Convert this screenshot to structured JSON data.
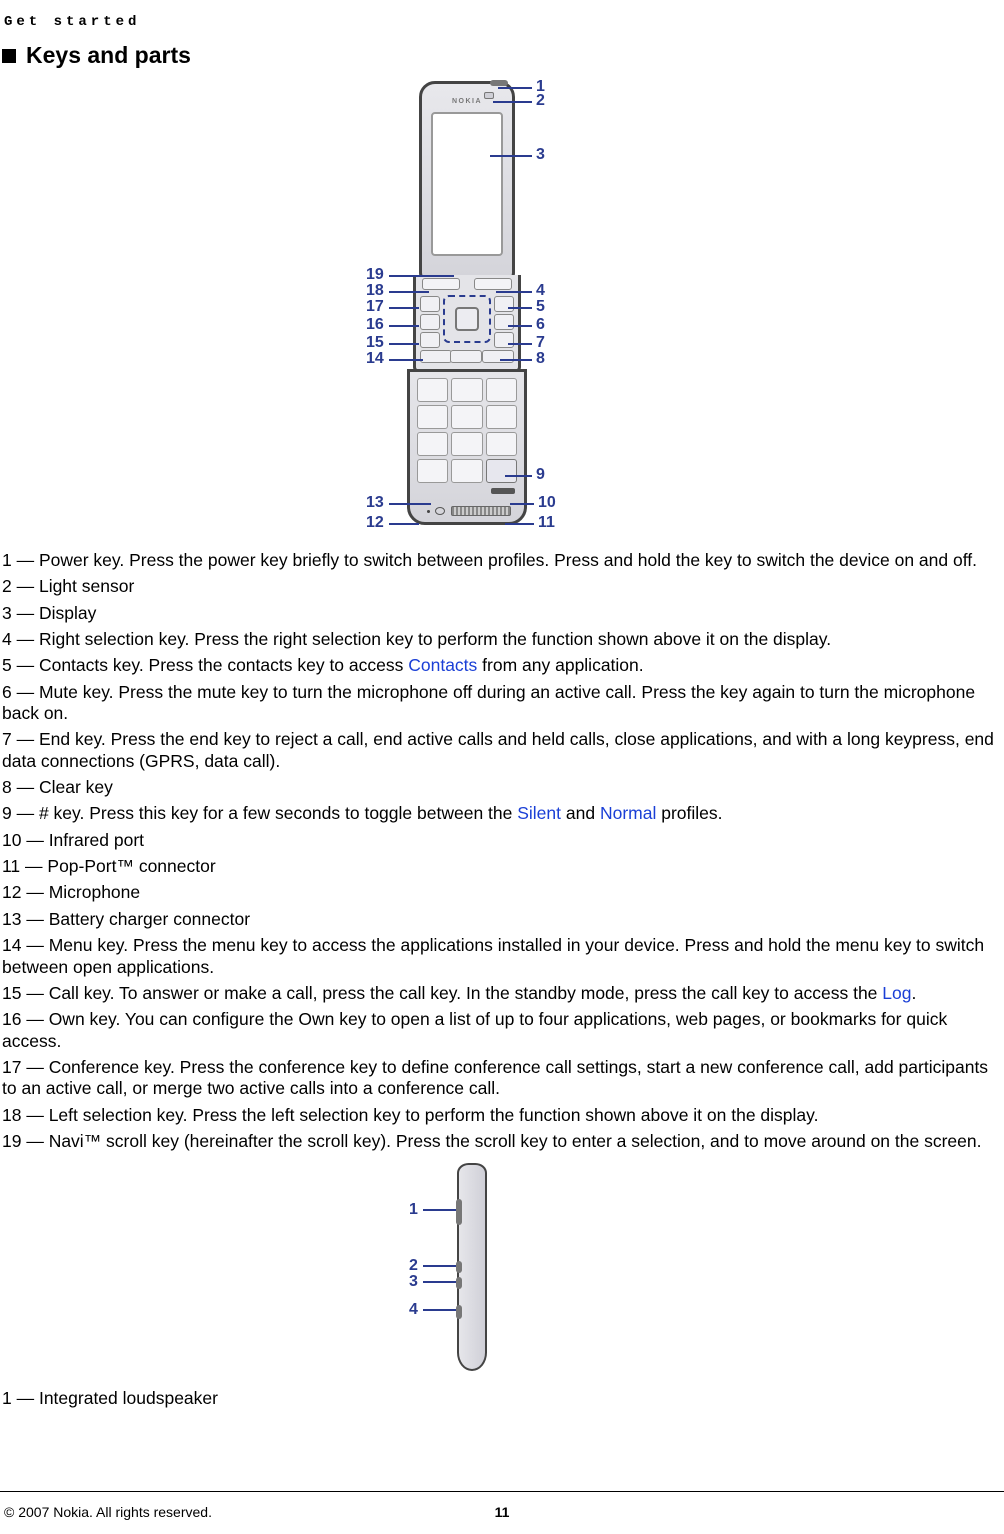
{
  "running_head": "Get started",
  "section_title": "Keys and parts",
  "diagram_front_labels": {
    "r1": "1",
    "r2": "2",
    "r3": "3",
    "r4": "4",
    "r5": "5",
    "r6": "6",
    "r7": "7",
    "r8": "8",
    "r9": "9",
    "r10": "10",
    "r11": "11",
    "l12": "12",
    "l13": "13",
    "l14": "14",
    "l15": "15",
    "l16": "16",
    "l17": "17",
    "l18": "18",
    "l19": "19"
  },
  "phone_brand": "NOKIA",
  "items": {
    "i1": "1 — Power key. Press the power key briefly to switch between profiles. Press and hold the key to switch the device on and off.",
    "i2": "2 — Light sensor",
    "i3": "3 — Display",
    "i4": "4 — Right selection key. Press the right selection key to perform the function shown above it on the display.",
    "i5_pre": "5 — Contacts key. Press the contacts key to access ",
    "i5_kw": "Contacts",
    "i5_post": " from any application.",
    "i6": "6 — Mute key. Press the mute key to turn the microphone off during an active call. Press the key again to turn the microphone back on.",
    "i7": "7 — End key. Press the end key to reject a call, end active calls and held calls, close applications, and with a long keypress, end data connections (GPRS, data call).",
    "i8": "8 — Clear key",
    "i9_pre": "9 — # key. Press this key for a few seconds to toggle between the ",
    "i9_kw1": "Silent",
    "i9_mid": " and ",
    "i9_kw2": "Normal",
    "i9_post": " profiles.",
    "i10": "10 — Infrared port",
    "i11": "11 — Pop-Port™ connector",
    "i12": "12 — Microphone",
    "i13": "13 — Battery charger connector",
    "i14": "14 — Menu key. Press the menu key to access the applications installed in your device. Press and hold the menu key to switch between open applications.",
    "i15_pre": "15 — Call key. To answer or make a call, press the call key. In the standby mode, press the call key to access the ",
    "i15_kw": "Log",
    "i15_post": ".",
    "i16": "16 — Own key. You can configure the Own key to open a list of up to four applications, web pages, or bookmarks for quick access.",
    "i17": "17 — Conference key. Press the conference key to define conference call settings, start a new conference call, add participants to an active call, or merge two active calls into a conference call.",
    "i18": "18 — Left selection key. Press the left selection key to perform the function shown above it on the display.",
    "i19": "19 — Navi™ scroll key (hereinafter the scroll key). Press the scroll key to enter a selection, and to move around on the screen."
  },
  "diagram_side_labels": {
    "s1": "1",
    "s2": "2",
    "s3": "3",
    "s4": "4"
  },
  "side_item": "1 — Integrated loudspeaker",
  "footer": {
    "copyright": "© 2007 Nokia. All rights reserved.",
    "page_number": "11"
  }
}
